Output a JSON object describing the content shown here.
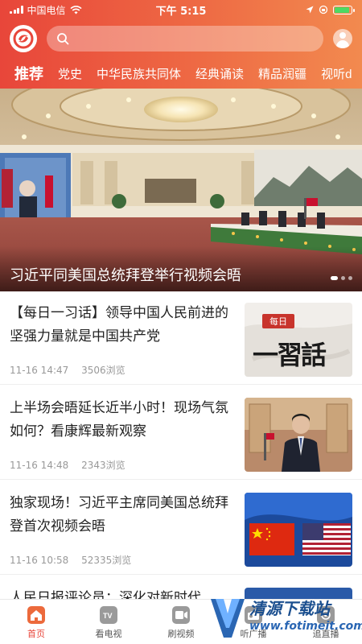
{
  "status_bar": {
    "carrier": "中国电信",
    "time": "下午 5:15"
  },
  "search": {
    "placeholder": ""
  },
  "tabs": [
    {
      "label": "推荐",
      "active": true
    },
    {
      "label": "党史"
    },
    {
      "label": "中华民族共同体"
    },
    {
      "label": "经典诵读"
    },
    {
      "label": "精品润疆"
    },
    {
      "label": "视听d"
    }
  ],
  "hero": {
    "caption": "习近平同美国总统拜登举行视频会晤"
  },
  "news": [
    {
      "title": "【每日一习话】领导中国人民前进的坚强力量就是中国共产党",
      "date": "11-16 14:47",
      "views": "3506浏览",
      "thumb_text_top": "每日",
      "thumb_text_main": "一習話"
    },
    {
      "title": "上半场会晤延长近半小时！现场气氛如何？看康辉最新观察",
      "date": "11-16 14:48",
      "views": "2343浏览"
    },
    {
      "title": "独家现场！习近平主席同美国总统拜登首次视频会晤",
      "date": "11-16 10:58",
      "views": "52335浏览"
    },
    {
      "title": "人民日报评论员：深化对新时代"
    }
  ],
  "bottom_nav": [
    {
      "label": "首页",
      "active": true,
      "icon": "home-icon"
    },
    {
      "label": "看电视",
      "icon": "tv-icon"
    },
    {
      "label": "刷视频",
      "icon": "video-icon"
    },
    {
      "label": "听广播",
      "icon": "radio-icon"
    },
    {
      "label": "追直播",
      "icon": "live-icon"
    }
  ],
  "watermark": {
    "title": "清源下载站",
    "url": "www.fotimeit.com"
  },
  "colors": {
    "header_start": "#e8463a",
    "header_end": "#f28a4f",
    "accent": "#e8463a"
  }
}
